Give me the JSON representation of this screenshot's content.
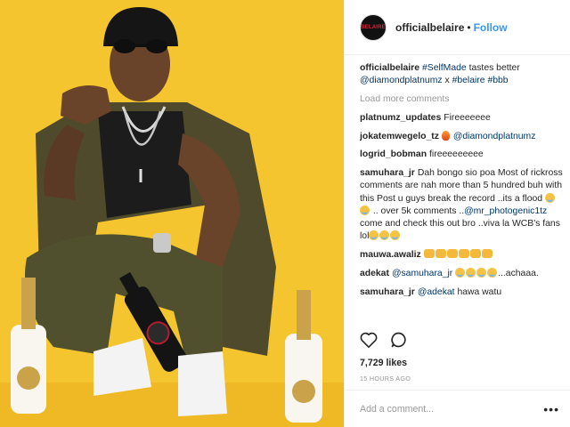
{
  "post": {
    "account": "officialbelaire",
    "separator": "•",
    "follow_label": "Follow",
    "avatar_text": "BELAIRE",
    "photo_bottle_label": "BELAIRE",
    "caption": {
      "user": "officialbelaire",
      "parts": [
        {
          "type": "tag",
          "text": "#SelfMade"
        },
        {
          "type": "text",
          "text": " tastes better "
        },
        {
          "type": "tag",
          "text": "@diamondplatnumz"
        },
        {
          "type": "text",
          "text": " x "
        },
        {
          "type": "tag",
          "text": "#belaire"
        },
        {
          "type": "text",
          "text": " "
        },
        {
          "type": "tag",
          "text": "#bbb"
        }
      ]
    },
    "load_more_label": "Load more comments",
    "comments": [
      {
        "user": "platnumz_updates",
        "parts": [
          {
            "type": "text",
            "text": "Fireeeeeee"
          }
        ]
      },
      {
        "user": "jokatemwegelo_tz",
        "parts": [
          {
            "type": "emoji",
            "icon": "fire"
          },
          {
            "type": "text",
            "text": " "
          },
          {
            "type": "tag",
            "text": "@diamondplatnumz"
          }
        ]
      },
      {
        "user": "logrid_bobman",
        "parts": [
          {
            "type": "text",
            "text": "fireeeeeeeee"
          }
        ]
      },
      {
        "user": "samuhara_jr",
        "parts": [
          {
            "type": "text",
            "text": "Dah bongo sio poa Most of rickross comments are nah more than 5 hundred buh with this Post u guys break the record ..its a flood "
          },
          {
            "type": "emoji",
            "icon": "cry"
          },
          {
            "type": "emoji",
            "icon": "cry"
          },
          {
            "type": "text",
            "text": " .. over 5k comments .."
          },
          {
            "type": "tag",
            "text": "@mr_photogenic1tz"
          },
          {
            "type": "text",
            "text": " come and check this out bro ..viva la WCB's fans lol"
          },
          {
            "type": "emoji",
            "icon": "cry"
          },
          {
            "type": "emoji",
            "icon": "cry"
          },
          {
            "type": "emoji",
            "icon": "cry"
          }
        ]
      },
      {
        "user": "mauwa.awaliz",
        "parts": [
          {
            "type": "emoji",
            "icon": "fist"
          },
          {
            "type": "emoji",
            "icon": "fist"
          },
          {
            "type": "emoji",
            "icon": "fist"
          },
          {
            "type": "emoji",
            "icon": "fist"
          },
          {
            "type": "emoji",
            "icon": "fist"
          },
          {
            "type": "emoji",
            "icon": "fist"
          }
        ]
      },
      {
        "user": "adekat",
        "parts": [
          {
            "type": "tag",
            "text": "@samuhara_jr"
          },
          {
            "type": "text",
            "text": " "
          },
          {
            "type": "emoji",
            "icon": "cry"
          },
          {
            "type": "emoji",
            "icon": "cry"
          },
          {
            "type": "emoji",
            "icon": "cry"
          },
          {
            "type": "emoji",
            "icon": "cry"
          },
          {
            "type": "text",
            "text": "...achaaa."
          }
        ]
      },
      {
        "user": "samuhara_jr",
        "parts": [
          {
            "type": "tag",
            "text": "@adekat"
          },
          {
            "type": "text",
            "text": " hawa watu"
          }
        ]
      }
    ],
    "likes": "7,729 likes",
    "time": "15 HOURS AGO",
    "add_comment_placeholder": "Add a comment...",
    "more_options": "•••",
    "colors": {
      "background_yellow": "#f4c52e",
      "link_blue": "#3897f0",
      "tag_blue": "#003569"
    }
  }
}
